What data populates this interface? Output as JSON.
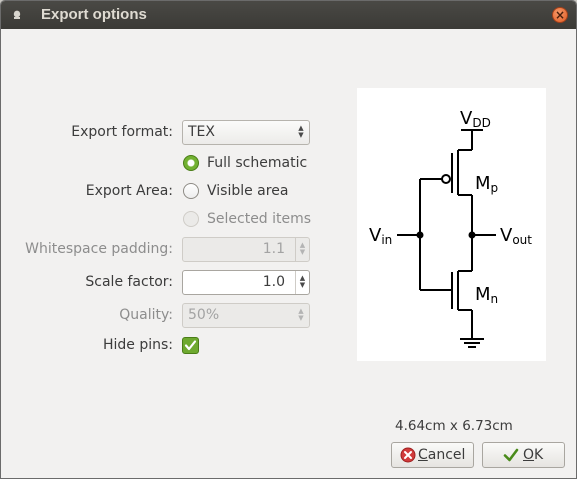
{
  "window": {
    "title": "Export options"
  },
  "form": {
    "export_format": {
      "label": "Export format:",
      "value": "TEX"
    },
    "export_area": {
      "label": "Export Area:",
      "options": [
        {
          "label": "Full schematic",
          "selected": true,
          "enabled": true
        },
        {
          "label": "Visible area",
          "selected": false,
          "enabled": true
        },
        {
          "label": "Selected items",
          "selected": false,
          "enabled": false
        }
      ]
    },
    "whitespace_padding": {
      "label": "Whitespace padding:",
      "value": "1.1",
      "enabled": false
    },
    "scale_factor": {
      "label": "Scale factor:",
      "value": "1.0",
      "enabled": true
    },
    "quality": {
      "label": "Quality:",
      "value": "50%",
      "enabled": false
    },
    "hide_pins": {
      "label": "Hide pins:",
      "checked": true
    }
  },
  "preview": {
    "labels": {
      "vdd": "V",
      "vdd_sub": "DD",
      "vin": "V",
      "vin_sub": "in",
      "vout": "V",
      "vout_sub": "out",
      "mp": "M",
      "mp_sub": "p",
      "mn": "M",
      "mn_sub": "n"
    }
  },
  "size": "4.64cm x 6.73cm",
  "buttons": {
    "cancel": {
      "label": "Cancel",
      "mnemonic": "C",
      "rest": "ancel"
    },
    "ok": {
      "label": "OK",
      "mnemonic": "O",
      "rest": "K"
    }
  },
  "colors": {
    "accent": "#6ea92f",
    "cancel_icon": "#d13b3b",
    "titlebar": "#3c3b37"
  }
}
